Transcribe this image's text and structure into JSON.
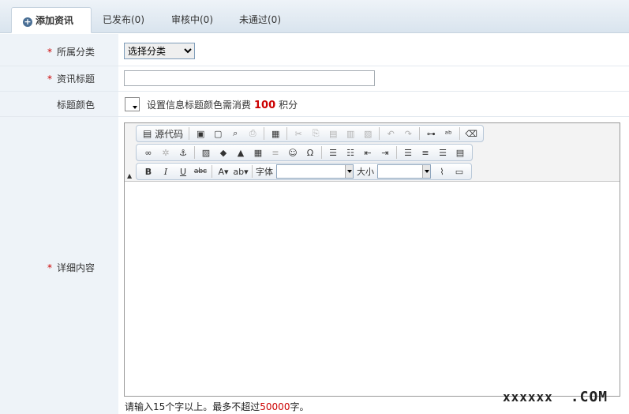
{
  "tabs": [
    {
      "label": "添加资讯"
    },
    {
      "label": "已发布(0)"
    },
    {
      "label": "审核中(0)"
    },
    {
      "label": "未通过(0)"
    }
  ],
  "form": {
    "required_mark": "*",
    "category_label": "所属分类",
    "category_value": "选择分类",
    "title_label": "资讯标题",
    "title_value": "",
    "color_label": "标题颜色",
    "color_text_before": "设置信息标题颜色需消费",
    "color_points": "100",
    "color_text_after": "积分",
    "content_label": "详细内容"
  },
  "editor": {
    "source_label": "源代码",
    "font_label": "字体",
    "size_label": "大小"
  },
  "hint": {
    "before": "请输入15个字以上。最多不超过",
    "max": "50000",
    "after": "字。"
  },
  "watermark": {
    "left": "xxxxxx",
    "right": ".COM"
  }
}
